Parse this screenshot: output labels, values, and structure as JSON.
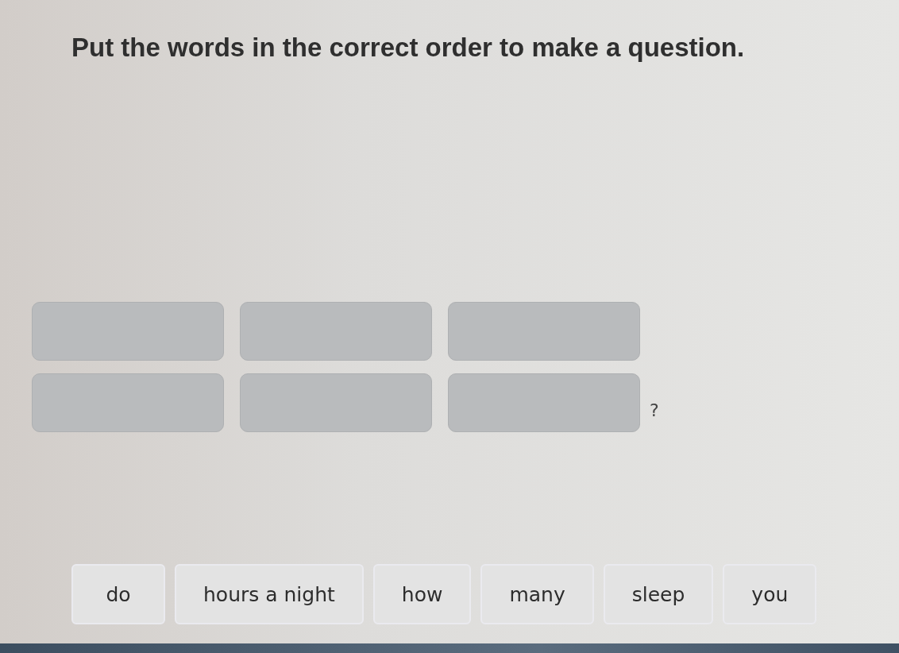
{
  "instruction": "Put the words in the correct order to make a question.",
  "answer_rows": [
    {
      "slots": [
        {
          "kind": "blank"
        },
        {
          "kind": "blank"
        },
        {
          "kind": "blank"
        }
      ]
    },
    {
      "slots": [
        {
          "kind": "blank"
        },
        {
          "kind": "blank"
        },
        {
          "kind": "blank"
        }
      ],
      "end_mark": "?"
    }
  ],
  "word_bank": [
    {
      "text": "do"
    },
    {
      "text": "hours a night"
    },
    {
      "text": "how"
    },
    {
      "text": "many"
    },
    {
      "text": "sleep"
    },
    {
      "text": "you"
    }
  ]
}
